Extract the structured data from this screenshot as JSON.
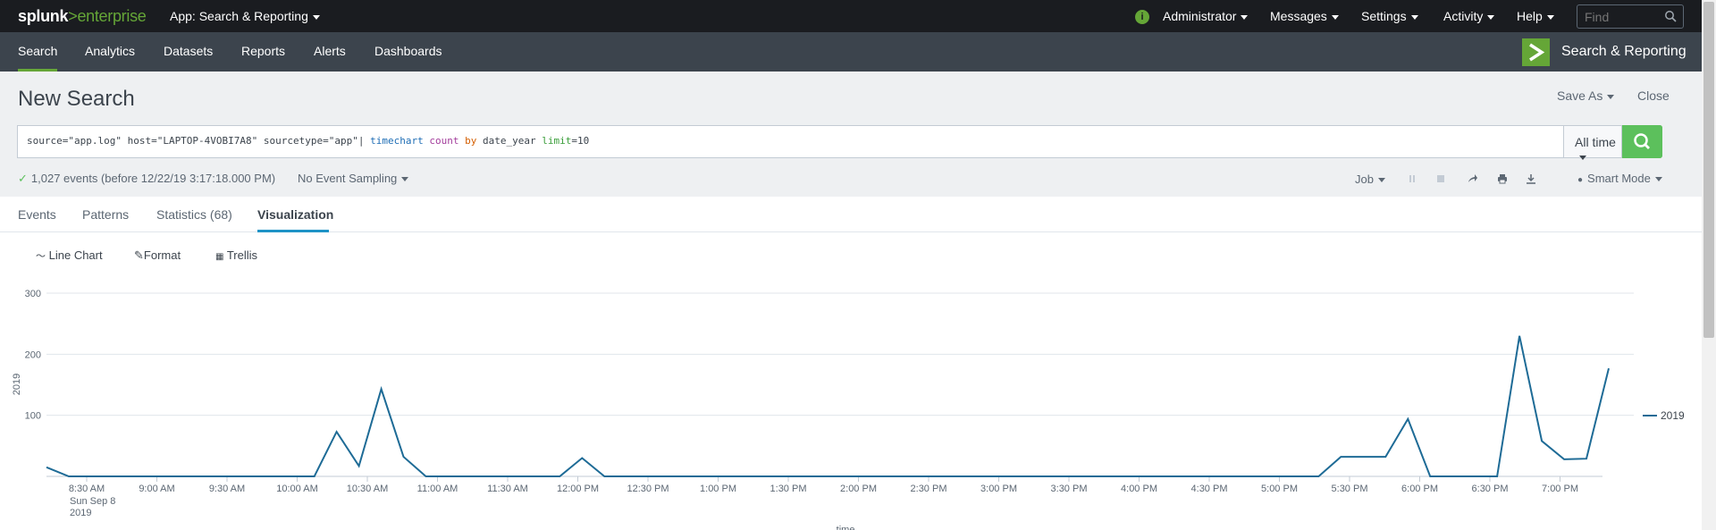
{
  "topbar": {
    "logo_splunk": "splunk",
    "logo_gt": ">",
    "logo_enterprise": "enterprise",
    "app_menu": "App: Search & Reporting",
    "items": [
      "Administrator",
      "Messages",
      "Settings",
      "Activity",
      "Help"
    ],
    "find_placeholder": "Find",
    "accent": "#65a637"
  },
  "appbar": {
    "nav": [
      "Search",
      "Analytics",
      "Datasets",
      "Reports",
      "Alerts",
      "Dashboards"
    ],
    "active": "Search",
    "app_title": "Search & Reporting"
  },
  "header": {
    "title": "New Search",
    "save_as": "Save As",
    "close": "Close"
  },
  "search": {
    "query_plain": "source=\"app.log\" host=\"LAPTOP-4VOBI7A8\" sourcetype=\"app\"| ",
    "query_cmd": "timechart",
    "query_fn": "count",
    "query_kw": "by",
    "query_field": "date_year",
    "query_arg": "limit",
    "query_val": "=10",
    "time_range": "All time"
  },
  "status": {
    "events": "1,027 events (before 12/22/19 3:17:18.000 PM)",
    "sampling": "No Event Sampling",
    "job": "Job",
    "mode": "Smart Mode"
  },
  "tabs": [
    {
      "label": "Events"
    },
    {
      "label": "Patterns"
    },
    {
      "label": "Statistics (68)"
    },
    {
      "label": "Visualization"
    }
  ],
  "viz_toolbar": {
    "chart_type": "Line Chart",
    "format": "Format",
    "trellis": "Trellis"
  },
  "chart_data": {
    "type": "line",
    "x": [
      "8:15 AM",
      "8:30 AM",
      "8:45 AM",
      "9:00 AM",
      "9:15 AM",
      "9:30 AM",
      "9:45 AM",
      "10:00 AM",
      "10:15 AM",
      "10:30 AM",
      "10:45 AM",
      "11:00 AM",
      "11:15 AM",
      "11:30 AM",
      "11:45 AM",
      "12:00 PM",
      "12:15 PM",
      "12:30 PM",
      "12:45 PM",
      "1:00 PM",
      "1:15 PM",
      "1:30 PM",
      "1:45 PM",
      "2:00 PM",
      "2:15 PM",
      "2:30 PM",
      "2:45 PM",
      "3:00 PM",
      "3:15 PM",
      "3:30 PM",
      "3:45 PM",
      "4:00 PM",
      "4:15 PM",
      "4:30 PM",
      "4:45 PM",
      "5:00 PM",
      "5:15 PM",
      "5:30 PM",
      "5:45 PM",
      "6:00 PM",
      "6:15 PM",
      "6:30 PM",
      "6:45 PM",
      "7:00 PM",
      "7:15 PM",
      "7:30 PM",
      "7:45 PM"
    ],
    "x_tick_labels": [
      "8:30 AM",
      "9:00 AM",
      "9:30 AM",
      "10:00 AM",
      "10:30 AM",
      "11:00 AM",
      "11:30 AM",
      "12:00 PM",
      "12:30 PM",
      "1:00 PM",
      "1:30 PM",
      "2:00 PM",
      "2:30 PM",
      "3:00 PM",
      "3:30 PM",
      "4:00 PM",
      "4:30 PM",
      "5:00 PM",
      "5:30 PM",
      "6:00 PM",
      "6:30 PM",
      "7:00 PM"
    ],
    "first_tick_sublabel": [
      "Sun Sep 8",
      "2019"
    ],
    "series": [
      {
        "name": "2019",
        "color": "#1e6b96",
        "values": [
          15,
          0,
          0,
          0,
          0,
          0,
          0,
          0,
          0,
          0,
          0,
          0,
          0,
          73,
          17,
          143,
          32,
          0,
          0,
          0,
          0,
          0,
          0,
          0,
          30,
          0,
          0,
          0,
          0,
          0,
          0,
          0,
          0,
          0,
          0,
          0,
          0,
          0,
          0,
          0,
          0,
          0,
          0,
          0,
          0,
          0,
          0,
          0,
          0,
          0,
          0,
          0,
          0,
          0,
          0,
          0,
          0,
          0,
          32,
          32,
          32,
          94,
          0,
          0,
          0,
          0,
          230,
          58,
          28,
          29,
          177
        ]
      }
    ],
    "yticks": [
      100,
      200,
      300
    ],
    "ylim": [
      0,
      300
    ],
    "ylabel": "2019",
    "xlabel": "_time",
    "legend": "right",
    "grid": true
  }
}
